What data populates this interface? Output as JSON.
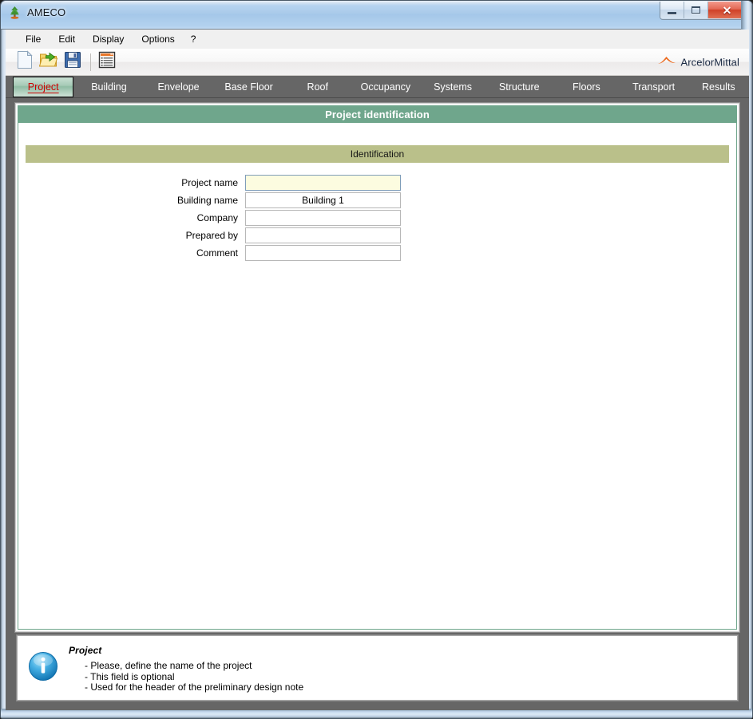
{
  "window": {
    "title": "AMECO",
    "app_icon": "tree-icon",
    "buttons": {
      "minimize": "minimize-icon",
      "maximize": "maximize-icon",
      "close": "close-icon"
    }
  },
  "menu": {
    "items": [
      {
        "label": "File"
      },
      {
        "label": "Edit"
      },
      {
        "label": "Display"
      },
      {
        "label": "Options"
      },
      {
        "label": "?"
      }
    ]
  },
  "toolbar": {
    "buttons": [
      {
        "name": "new-document-icon",
        "tooltip": "New"
      },
      {
        "name": "open-folder-icon",
        "tooltip": "Open"
      },
      {
        "name": "save-floppy-icon",
        "tooltip": "Save"
      },
      {
        "name": "report-icon",
        "tooltip": "Report"
      }
    ],
    "brand": {
      "text": "ArcelorMittal",
      "logo": "arcelormittal-logo-icon",
      "color": "#ed6b1f"
    }
  },
  "tabs": {
    "active": "Project",
    "items": [
      {
        "label": "Project"
      },
      {
        "label": "Building"
      },
      {
        "label": "Envelope"
      },
      {
        "label": "Base Floor"
      },
      {
        "label": "Roof"
      },
      {
        "label": "Occupancy"
      },
      {
        "label": "Systems"
      },
      {
        "label": "Structure"
      },
      {
        "label": "Floors"
      },
      {
        "label": "Transport"
      },
      {
        "label": "Results"
      }
    ]
  },
  "content": {
    "panel_title": "Project identification",
    "section_title": "Identification",
    "fields": [
      {
        "label": "Project name",
        "value": "",
        "placeholder": "",
        "focused": true
      },
      {
        "label": "Building name",
        "value": "Building 1",
        "placeholder": "",
        "focused": false
      },
      {
        "label": "Company",
        "value": "",
        "placeholder": "",
        "focused": false
      },
      {
        "label": "Prepared by",
        "value": "",
        "placeholder": "",
        "focused": false
      },
      {
        "label": "Comment",
        "value": "",
        "placeholder": "",
        "focused": false
      }
    ]
  },
  "info": {
    "icon": "info-circle-icon",
    "title": "Project",
    "lines": [
      "- Please, define the name of the project",
      "- This field is optional",
      "- Used for the header of the preliminary design note"
    ]
  },
  "colors": {
    "panel_header_green": "#6fa68c",
    "section_khaki": "#bac08a",
    "tabstrip_gray": "#666666",
    "active_tab_text": "#cc0000",
    "focused_field_bg": "#fcfce0",
    "brand_orange": "#ed6b1f",
    "info_blue": "#2f9bd6"
  }
}
